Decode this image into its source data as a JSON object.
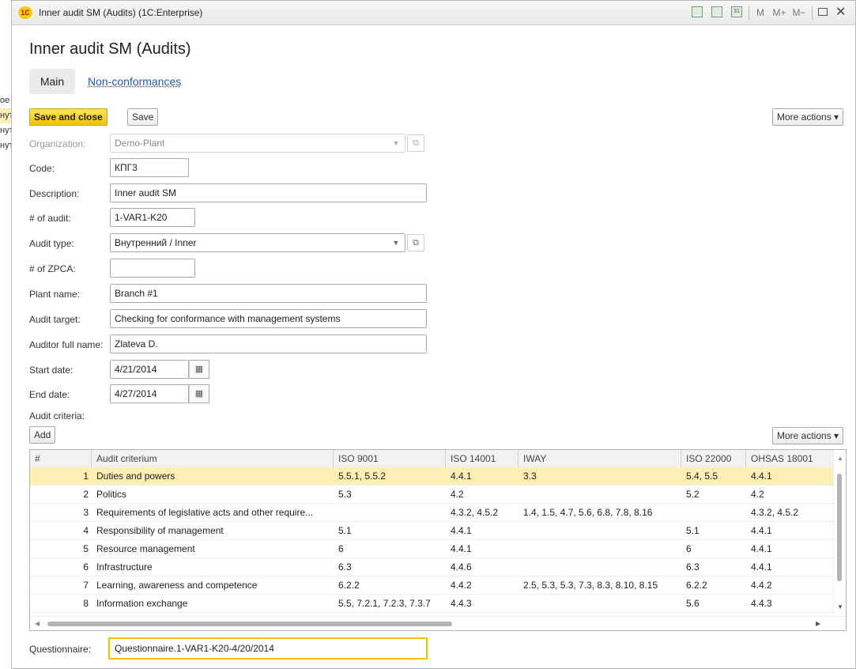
{
  "side_strip": [
    "ое",
    "нут",
    "нут",
    "нут"
  ],
  "window": {
    "title": "Inner audit SM (Audits)  (1C:Enterprise)",
    "logo": "1С",
    "toolbar_m": [
      "M",
      "M+",
      "M−"
    ],
    "calendar_day": "31"
  },
  "form": {
    "title": "Inner audit SM (Audits)",
    "tabs": [
      "Main",
      "Non-conformances"
    ],
    "save_close_label": "Save and close",
    "save_label": "Save",
    "more_actions_label": "More actions ▾",
    "add_label": "Add"
  },
  "fields": {
    "organization": {
      "label": "Organization:",
      "value": "Demo-Plant"
    },
    "code": {
      "label": "Code:",
      "value": "КПГ3"
    },
    "description": {
      "label": "Description:",
      "value": "Inner audit SM"
    },
    "audit_no": {
      "label": "# of audit:",
      "value": "1-VAR1-K20"
    },
    "audit_type": {
      "label": "Audit type:",
      "value": "Внутренний / Inner"
    },
    "zpca": {
      "label": "# of ZPCA:",
      "value": ""
    },
    "plant_name": {
      "label": "Plant name:",
      "value": "Branch #1"
    },
    "audit_target": {
      "label": "Audit target:",
      "value": "Checking for conformance with management systems"
    },
    "auditor": {
      "label": "Auditor full name:",
      "value": "Zlateva D."
    },
    "start_date": {
      "label": "Start date:",
      "value": "4/21/2014"
    },
    "end_date": {
      "label": "End date:",
      "value": "4/27/2014"
    },
    "criteria_label": "Audit criteria:",
    "questionnaire": {
      "label": "Questionnaire:",
      "value": "Questionnaire.1-VAR1-K20-4/20/2014"
    }
  },
  "table": {
    "columns": [
      "#",
      "Audit criterium",
      "ISO 9001",
      "ISO 14001",
      "IWAY",
      "ISO 22000",
      "OHSAS 18001"
    ],
    "rows": [
      [
        "1",
        "Duties and powers",
        "5.5.1, 5.5.2",
        "4.4.1",
        "3.3",
        "5.4, 5.5",
        "4.4.1"
      ],
      [
        "2",
        "Politics",
        "5.3",
        "4.2",
        "",
        "5.2",
        "4.2"
      ],
      [
        "3",
        "Requirements of legislative acts and other require...",
        "",
        "4.3.2, 4.5.2",
        "1.4, 1.5, 4.7, 5.6, 6.8, 7.8, 8.16",
        "",
        "4.3.2, 4.5.2"
      ],
      [
        "4",
        "Responsibility of management",
        "5.1",
        "4.4.1",
        "",
        "5.1",
        "4.4.1"
      ],
      [
        "5",
        "Resource management",
        "6",
        "4.4.1",
        "",
        "6",
        "4.4.1"
      ],
      [
        "6",
        "Infrastructure",
        "6.3",
        "4.4.6",
        "",
        "6.3",
        "4.4.1"
      ],
      [
        "7",
        "Learning, awareness and competence",
        "6.2.2",
        "4.4.2",
        "2.5, 5.3, 5.3, 7.3, 8.3, 8.10, 8.15",
        "6.2.2",
        "4.4.2"
      ],
      [
        "8",
        "Information exchange",
        "5.5, 7.2.1, 7.2.3, 7.3.7",
        "4.4.3",
        "",
        "5.6",
        "4.4.3"
      ]
    ]
  }
}
